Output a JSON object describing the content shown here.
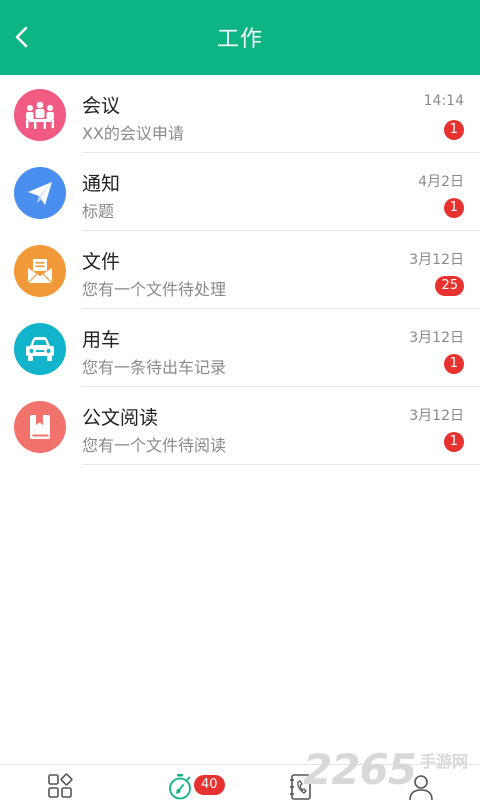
{
  "header": {
    "title": "工作"
  },
  "colors": {
    "accent": "#0cb583",
    "badge": "#e8322f",
    "meeting": "#f05a83",
    "notice": "#4a8ef0",
    "file": "#f29a3a",
    "car": "#12b4cc",
    "reading": "#f2736b"
  },
  "items": [
    {
      "title": "会议",
      "subtitle": "XX的会议申请",
      "time": "14:14",
      "badge": "1",
      "icon": "meeting-people-icon"
    },
    {
      "title": "通知",
      "subtitle": "标题",
      "time": "4月2日",
      "badge": "1",
      "icon": "paper-plane-icon"
    },
    {
      "title": "文件",
      "subtitle": "您有一个文件待处理",
      "time": "3月12日",
      "badge": "25",
      "icon": "envelope-icon"
    },
    {
      "title": "用车",
      "subtitle": "您有一条待出车记录",
      "time": "3月12日",
      "badge": "1",
      "icon": "car-icon"
    },
    {
      "title": "公文阅读",
      "subtitle": "您有一个文件待阅读",
      "time": "3月12日",
      "badge": "1",
      "icon": "book-icon"
    }
  ],
  "tabbar": {
    "tabs": [
      {
        "icon": "apps-grid-icon"
      },
      {
        "icon": "stopwatch-icon",
        "badge": "40"
      },
      {
        "icon": "phonebook-icon"
      },
      {
        "icon": "person-icon"
      }
    ]
  },
  "watermark": {
    "number": "2265",
    "text": "手游网"
  }
}
